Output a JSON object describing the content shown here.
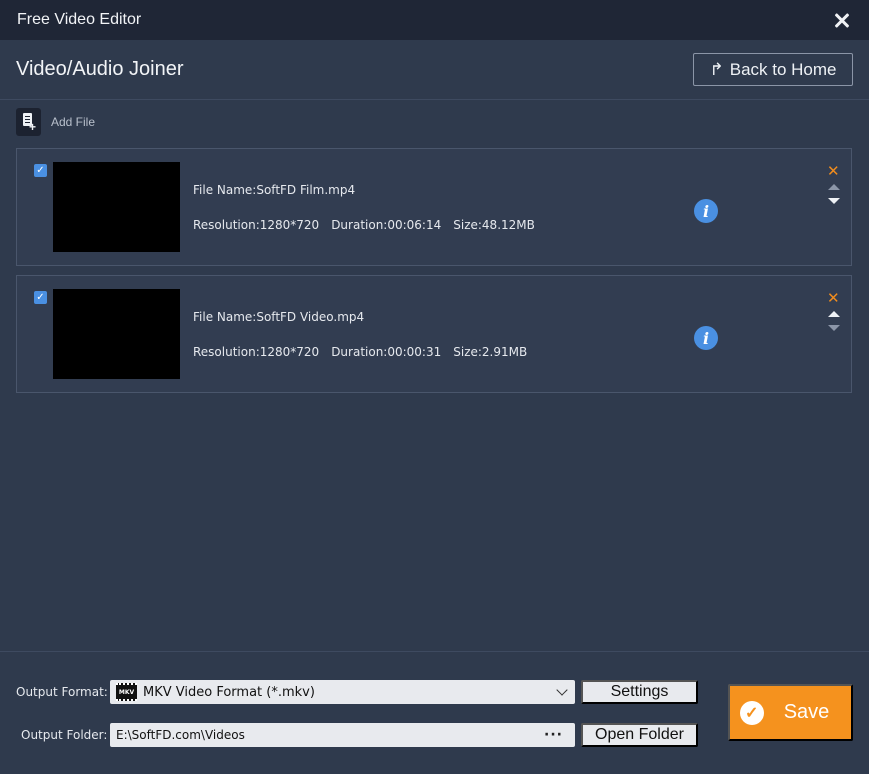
{
  "window": {
    "title": "Free Video Editor"
  },
  "header": {
    "title": "Video/Audio Joiner",
    "back_label": "Back to Home"
  },
  "toolbar": {
    "add_file_label": "Add File"
  },
  "files": [
    {
      "checked": true,
      "name": "File Name:SoftFD Film.mp4",
      "resolution": "Resolution:1280*720",
      "duration": "Duration:00:06:14",
      "size": "Size:48.12MB"
    },
    {
      "checked": true,
      "name": "File Name:SoftFD Video.mp4",
      "resolution": "Resolution:1280*720",
      "duration": "Duration:00:00:31",
      "size": "Size:2.91MB"
    }
  ],
  "footer": {
    "output_format_label": "Output Format:",
    "output_format_value": "MKV Video Format (*.mkv)",
    "format_icon_text": "MKV",
    "settings_label": "Settings",
    "output_folder_label": "Output Folder:",
    "output_folder_value": "E:\\SoftFD.com\\Videos",
    "open_folder_label": "Open Folder",
    "save_label": "Save"
  },
  "colors": {
    "background": "#2f3a4d",
    "titlebar": "#1f2636",
    "accent": "#f5921e",
    "info": "#4a90e2"
  }
}
